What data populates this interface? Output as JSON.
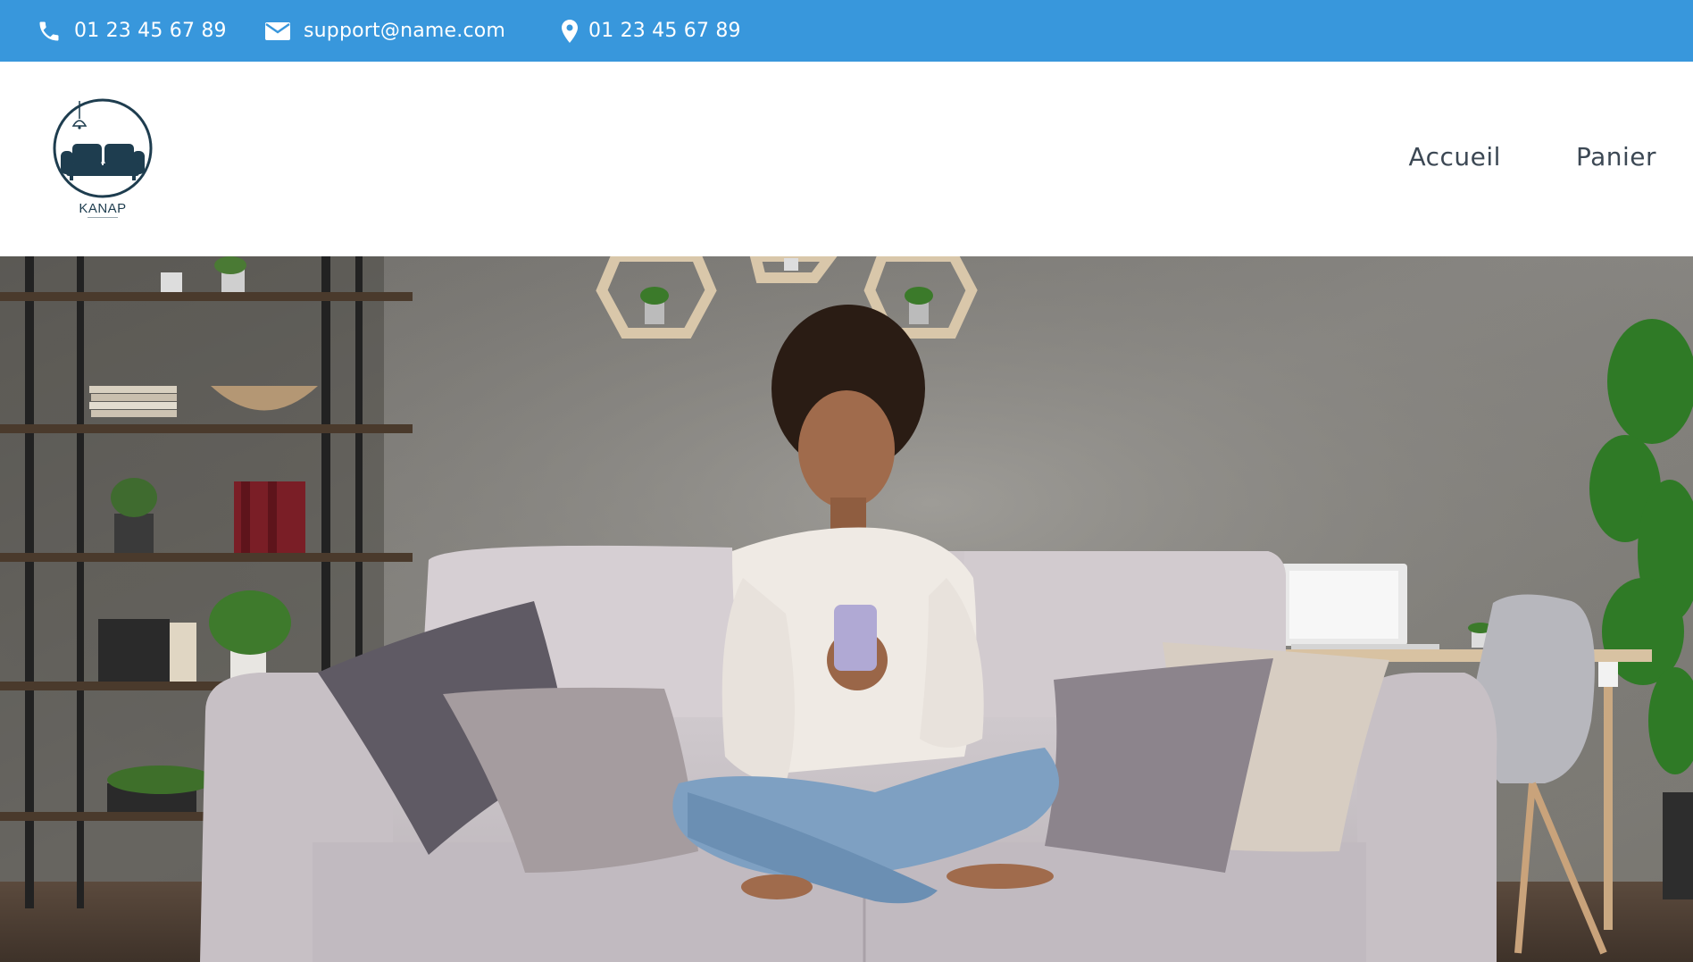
{
  "topbar": {
    "background_color": "#3897dc",
    "phone": {
      "icon": "phone-icon",
      "text": "01 23 45 67 89"
    },
    "email": {
      "icon": "envelope-icon",
      "text": "support@name.com"
    },
    "location": {
      "icon": "map-pin-icon",
      "text": "01 23 45 67 89"
    }
  },
  "header": {
    "logo": {
      "icon": "sofa-logo-icon",
      "brand": "KANAP"
    },
    "nav": [
      {
        "label": "Accueil"
      },
      {
        "label": "Panier"
      }
    ]
  },
  "hero": {
    "image": "woman-on-sofa-using-phone"
  }
}
